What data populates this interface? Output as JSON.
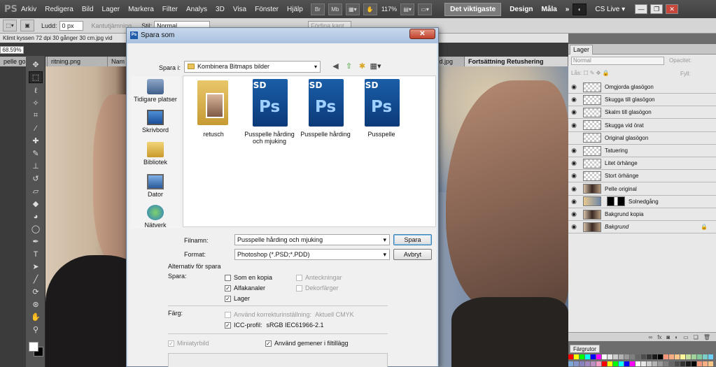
{
  "menubar": {
    "logo": "PS",
    "items": [
      "Arkiv",
      "Redigera",
      "Bild",
      "Lager",
      "Markera",
      "Filter",
      "Analys",
      "3D",
      "Visa",
      "Fönster",
      "Hjälp"
    ],
    "zoom": "117%",
    "workspaces": {
      "active": "Det viktigaste",
      "design": "Design",
      "paint": "Måla",
      "more": "»"
    },
    "cslive": "CS Live"
  },
  "options": {
    "feather_label": "Ludd:",
    "feather_value": "0 px",
    "antialias": "Kantutjämning",
    "style_label": "Stil:",
    "style_value": "Normal",
    "refine": "Förfina kant"
  },
  "infobar": {
    "text": "Klimt kyssen 72 dpi 30 gånger 30 cm.jpg vid"
  },
  "zoom_field": "68.59%",
  "doc_tabs": [
    "pelle go",
    "ritning.png",
    "Nam",
    "bakgrund.jpg",
    "Fortsättning Retushering"
  ],
  "dialog": {
    "title": "Spara som",
    "look_in_label": "Spara i:",
    "look_in_value": "Kombinera Bitmaps bilder",
    "places": [
      "Tidigare platser",
      "Skrivbord",
      "Bibliotek",
      "Dator",
      "Nätverk"
    ],
    "files": [
      {
        "name": "retusch",
        "type": "folder"
      },
      {
        "name": "Pusspelle hårding och mjuking",
        "type": "psd",
        "tag": "PSD",
        "mark": "Ps"
      },
      {
        "name": "Pusspelle hårding",
        "type": "psd",
        "tag": "PSD",
        "mark": "Ps"
      },
      {
        "name": "Pusspelle",
        "type": "psd",
        "tag": "PSD",
        "mark": "Ps"
      }
    ],
    "filename_label": "Filnamn:",
    "filename_value": "Pusspelle hårding och mjuking",
    "format_label": "Format:",
    "format_value": "Photoshop (*.PSD;*.PDD)",
    "save_button": "Spara",
    "cancel_button": "Avbryt",
    "options_title": "Alternativ för spara",
    "save_label": "Spara:",
    "checkboxes": {
      "as_copy": {
        "label": "Som en kopia",
        "checked": false
      },
      "alpha": {
        "label": "Alfakanaler",
        "checked": true
      },
      "layers": {
        "label": "Lager",
        "checked": true
      },
      "notes": {
        "label": "Anteckningar",
        "checked": false
      },
      "spot": {
        "label": "Dekorfärger",
        "checked": false
      }
    },
    "color_label": "Färg:",
    "proof": {
      "label": "Använd korrekturinställning:",
      "value": "Aktuell CMYK",
      "checked": false
    },
    "icc": {
      "label": "ICC-profil:",
      "value": "sRGB IEC61966-2.1",
      "checked": true
    },
    "thumbnail": {
      "label": "Miniatyrbild",
      "checked": true
    },
    "lowercase": {
      "label": "Använd gemener i filtillägg",
      "checked": true
    }
  },
  "layers": {
    "tab": "Lager",
    "blend_mode": "Normal",
    "opacity_label": "Opacitet:",
    "lock_label": "Lås:",
    "fill_label": "Fyll:",
    "items": [
      {
        "name": "Omgjorda glasögon",
        "visible": true
      },
      {
        "name": "Skugga till glasögon",
        "visible": true
      },
      {
        "name": "Skalm till glasögon",
        "visible": true
      },
      {
        "name": "Skugga vid örat",
        "visible": true
      },
      {
        "name": "Original glasögon",
        "visible": false
      },
      {
        "name": "Tatuering",
        "visible": true
      },
      {
        "name": "Litet örhänge",
        "visible": true
      },
      {
        "name": "Stort örhänge",
        "visible": true
      },
      {
        "name": "Pelle original",
        "visible": true
      },
      {
        "name": "Solnedgång",
        "visible": true
      },
      {
        "name": "Bakgrund kopia",
        "visible": true
      },
      {
        "name": "Bakgrund",
        "visible": true
      }
    ]
  },
  "swatches": {
    "tab": "Färgrutor"
  },
  "glyphs": {
    "eye": "◉",
    "lock": "🔒",
    "check": "✓",
    "dropdown": "▾"
  }
}
